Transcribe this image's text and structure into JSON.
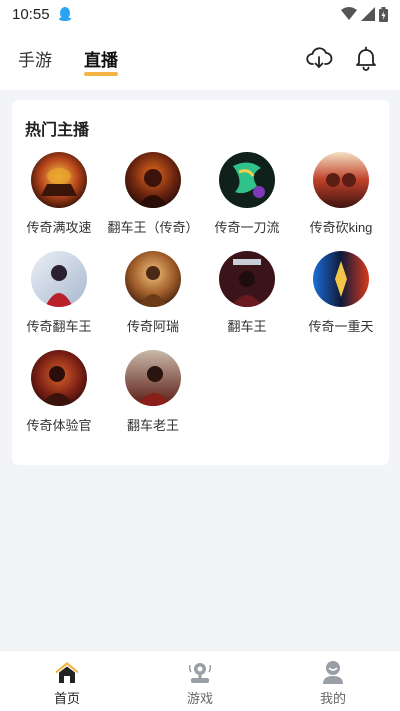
{
  "status_bar": {
    "time": "10:55",
    "icons": [
      "qq-icon",
      "wifi-icon",
      "signal-icon",
      "battery-icon"
    ]
  },
  "top_nav": {
    "tabs": [
      {
        "label": "手游",
        "active": false
      },
      {
        "label": "直播",
        "active": true
      }
    ],
    "actions": [
      "download-icon",
      "bell-icon"
    ]
  },
  "hot_streamers": {
    "title": "热门主播",
    "items": [
      {
        "name": "传奇满攻速"
      },
      {
        "name": "翻车王（传奇）"
      },
      {
        "name": "传奇一刀流"
      },
      {
        "name": "传奇砍king"
      },
      {
        "name": "传奇翻车王"
      },
      {
        "name": "传奇阿瑞"
      },
      {
        "name": "翻车王"
      },
      {
        "name": "传奇一重天"
      },
      {
        "name": "传奇体验官"
      },
      {
        "name": "翻车老王"
      }
    ]
  },
  "bottom_nav": {
    "items": [
      {
        "label": "首页",
        "icon": "home-icon",
        "active": true
      },
      {
        "label": "游戏",
        "icon": "joystick-icon",
        "active": false
      },
      {
        "label": "我的",
        "icon": "user-icon",
        "active": false
      }
    ]
  },
  "colors": {
    "accent": "#f5b544",
    "background": "#f3f4f8",
    "card": "#ffffff"
  }
}
